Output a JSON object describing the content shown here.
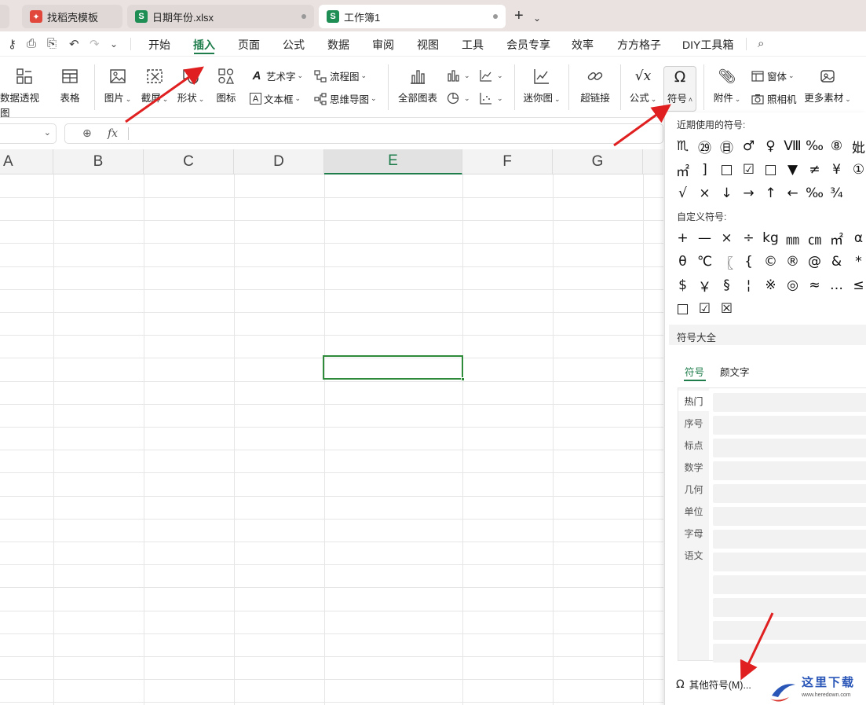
{
  "tabs": [
    {
      "label": "找稻壳模板"
    },
    {
      "label": "日期年份.xlsx"
    },
    {
      "label": "工作簿1"
    }
  ],
  "menu": [
    "开始",
    "插入",
    "页面",
    "公式",
    "数据",
    "审阅",
    "视图",
    "工具",
    "会员专享",
    "效率",
    "方方格子",
    "DIY工具箱"
  ],
  "ribbon": {
    "pivot": "数据透视图",
    "table": "表格",
    "picture": "图片",
    "screenshot": "截屏",
    "shape": "形状",
    "icon": "图标",
    "wordart": "艺术字",
    "textbox": "文本框",
    "flowchart": "流程图",
    "mindmap": "思维导图",
    "allcharts": "全部图表",
    "sparkline": "迷你图",
    "hyperlink": "超链接",
    "formula": "公式",
    "symbol": "符号",
    "attach": "附件",
    "window": "窗体",
    "camera": "照相机",
    "more": "更多素材"
  },
  "formula_bar": {
    "fx": "fx"
  },
  "columns": [
    "A",
    "B",
    "C",
    "D",
    "E",
    "F",
    "G"
  ],
  "selected_column": "E",
  "symbol_panel": {
    "recent_title": "近期使用的符号:",
    "recent": [
      "♏",
      "㉙",
      "㊐",
      "♂",
      "♀",
      "Ⅷ",
      "‰",
      "⑧",
      "妣",
      "㎡",
      "]",
      "□",
      "☑",
      "□",
      "▼",
      "≠",
      "¥",
      "①",
      "√",
      "×",
      "↓",
      "→",
      "↑",
      "←",
      "‰",
      "¾"
    ],
    "custom_title": "自定义符号:",
    "custom": [
      "+",
      "—",
      "×",
      "÷",
      "kg",
      "㎜",
      "㎝",
      "㎡",
      "α",
      "θ",
      "℃",
      "〖",
      "{",
      "©",
      "®",
      "@",
      "&",
      "*",
      "$",
      "￥",
      "§",
      "¦",
      "※",
      "◎",
      "≈",
      "…",
      "≤",
      "□",
      "☑",
      "☒"
    ],
    "all_title": "符号大全",
    "tab_symbol": "符号",
    "tab_kaomoji": "颜文字",
    "categories": [
      "热门",
      "序号",
      "标点",
      "数学",
      "几何",
      "单位",
      "字母",
      "语文"
    ],
    "more_button": "其他符号(M)...",
    "watermark_text": "这里下载",
    "watermark_url": "www.heredown.com"
  }
}
